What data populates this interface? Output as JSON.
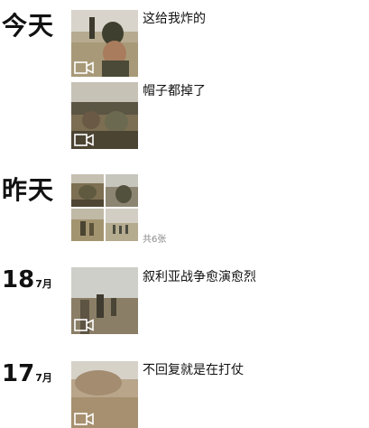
{
  "entries": [
    {
      "date": "今天",
      "type": "video",
      "caption": "这给我炸的"
    },
    {
      "type": "video",
      "caption": "帽子都掉了"
    },
    {
      "date": "昨天",
      "type": "photos",
      "count": "共6张"
    },
    {
      "day": "18",
      "month": "7月",
      "type": "video",
      "caption": "叙利亚战争愈演愈烈"
    },
    {
      "day": "17",
      "month": "7月",
      "type": "video",
      "caption": "不回复就是在打仗"
    }
  ],
  "icons": {
    "video": "video-camera-icon"
  },
  "colors": {
    "text": "#111111",
    "muted": "#8a8a8a",
    "background": "#ffffff"
  }
}
